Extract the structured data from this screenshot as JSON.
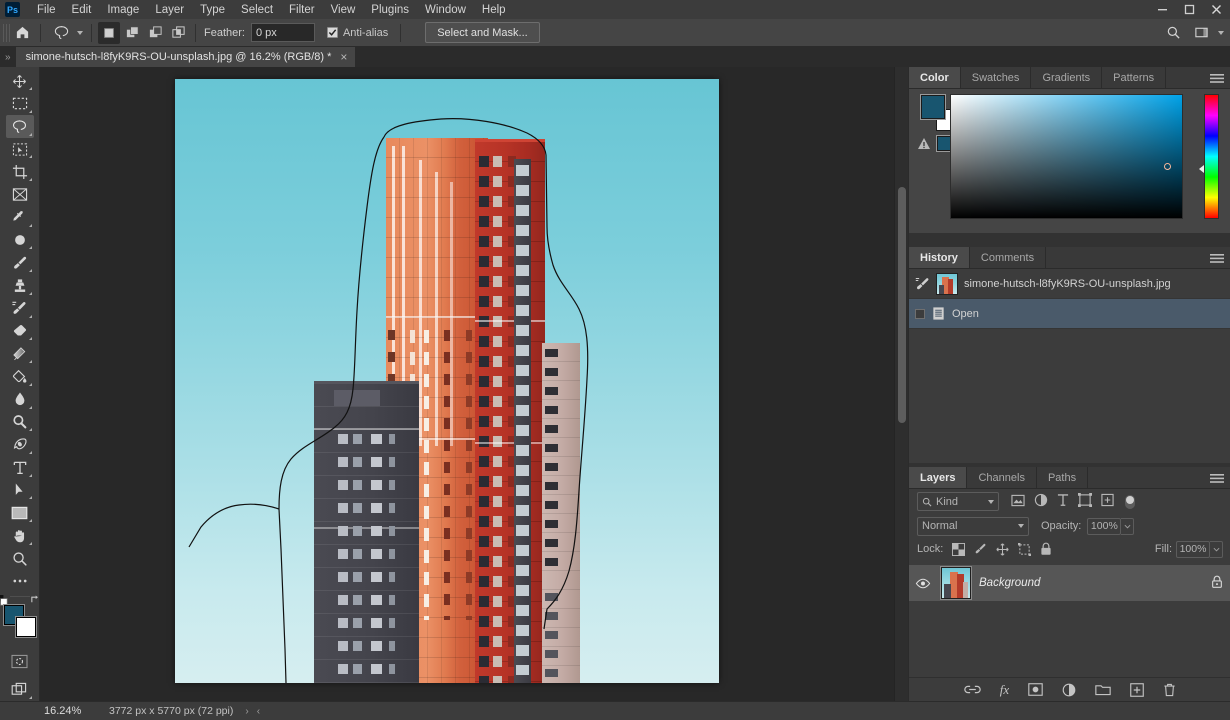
{
  "app": {
    "name": "Adobe Photoshop",
    "logo_text": "Ps"
  },
  "menubar": {
    "items": [
      {
        "label": "File"
      },
      {
        "label": "Edit"
      },
      {
        "label": "Image"
      },
      {
        "label": "Layer"
      },
      {
        "label": "Type"
      },
      {
        "label": "Select"
      },
      {
        "label": "Filter"
      },
      {
        "label": "View"
      },
      {
        "label": "Plugins"
      },
      {
        "label": "Window"
      },
      {
        "label": "Help"
      }
    ]
  },
  "window_controls": {
    "minimize": "minimize-button",
    "maximize": "maximize-button",
    "close": "close-button"
  },
  "options_bar": {
    "home_icon": "home-icon",
    "active_tool_icon": "lasso-tool-icon",
    "selection_modes": [
      {
        "name": "new-selection",
        "active": true
      },
      {
        "name": "add-to-selection",
        "active": false
      },
      {
        "name": "subtract-from-selection",
        "active": false
      },
      {
        "name": "intersect-with-selection",
        "active": false
      }
    ],
    "feather_label": "Feather:",
    "feather_value": "0 px",
    "antialias_label": "Anti-alias",
    "antialias_checked": true,
    "select_and_mask_label": "Select and Mask...",
    "search_icon": "search-icon",
    "workspace_icon": "workspace-switcher-icon"
  },
  "document_tab": {
    "title": "simone-hutsch-l8fyK9RS-OU-unsplash.jpg @ 16.2% (RGB/8) *",
    "close_label": "×",
    "overflow_label": "»"
  },
  "toolbar": {
    "tools": [
      {
        "name": "move-tool",
        "icon": "move-icon",
        "active": false,
        "has_flyout": true
      },
      {
        "name": "rectangular-marquee-tool",
        "icon": "marquee-icon",
        "active": false,
        "has_flyout": true
      },
      {
        "name": "lasso-tool",
        "icon": "lasso-icon",
        "active": true,
        "has_flyout": true
      },
      {
        "name": "object-selection-tool",
        "icon": "object-select-icon",
        "active": false,
        "has_flyout": true
      },
      {
        "name": "crop-tool",
        "icon": "crop-icon",
        "active": false,
        "has_flyout": true
      },
      {
        "name": "frame-tool",
        "icon": "frame-icon",
        "active": false,
        "has_flyout": false
      },
      {
        "name": "eyedropper-tool",
        "icon": "eyedropper-icon",
        "active": false,
        "has_flyout": true
      },
      {
        "name": "spot-healing-brush-tool",
        "icon": "healing-icon",
        "active": false,
        "has_flyout": true
      },
      {
        "name": "brush-tool",
        "icon": "brush-icon",
        "active": false,
        "has_flyout": true
      },
      {
        "name": "clone-stamp-tool",
        "icon": "clone-stamp-icon",
        "active": false,
        "has_flyout": true
      },
      {
        "name": "history-brush-tool",
        "icon": "history-brush-icon",
        "active": false,
        "has_flyout": true
      },
      {
        "name": "eraser-tool",
        "icon": "eraser-icon",
        "active": false,
        "has_flyout": true
      },
      {
        "name": "gradient-tool",
        "icon": "gradient-icon",
        "active": false,
        "has_flyout": true
      },
      {
        "name": "paint-bucket-tool",
        "icon": "paint-bucket-icon",
        "active": false,
        "has_flyout": true
      },
      {
        "name": "blur-tool",
        "icon": "blur-drop-icon",
        "active": false,
        "has_flyout": true
      },
      {
        "name": "dodge-tool",
        "icon": "dodge-icon",
        "active": false,
        "has_flyout": true
      },
      {
        "name": "pen-tool",
        "icon": "pen-icon",
        "active": false,
        "has_flyout": true
      },
      {
        "name": "type-tool",
        "icon": "type-t-icon",
        "active": false,
        "has_flyout": true
      },
      {
        "name": "path-selection-tool",
        "icon": "path-arrow-icon",
        "active": false,
        "has_flyout": true
      },
      {
        "name": "rectangle-tool",
        "icon": "rectangle-icon",
        "active": false,
        "has_flyout": true
      },
      {
        "name": "hand-tool",
        "icon": "hand-icon",
        "active": false,
        "has_flyout": true
      },
      {
        "name": "zoom-tool",
        "icon": "zoom-magnifier-icon",
        "active": false,
        "has_flyout": false
      },
      {
        "name": "edit-toolbar",
        "icon": "ellipsis-icon",
        "active": false,
        "has_flyout": false
      }
    ],
    "foreground_color": "#18556f",
    "background_color": "#ffffff",
    "quick_mask_icon": "quick-mask-icon",
    "screen_mode_icon": "screen-mode-icon",
    "swap_colors_icon": "swap-colors-icon",
    "default_colors_icon": "default-colors-icon"
  },
  "canvas": {
    "document_name": "simone-hutsch-l8fyK9RS-OU-unsplash.jpg",
    "selection_active": true,
    "selection_tool": "lasso",
    "sky_color_top": "#67c5d4",
    "sky_color_bottom": "#d6eef0",
    "orange_building_color": "#e8895c",
    "red_building_color": "#c0392b",
    "grey_building_color": "#4a4a52",
    "beige_building_color": "#cdb8b2"
  },
  "color_panel": {
    "tabs": [
      {
        "label": "Color",
        "active": true
      },
      {
        "label": "Swatches",
        "active": false
      },
      {
        "label": "Gradients",
        "active": false
      },
      {
        "label": "Patterns",
        "active": false
      }
    ],
    "menu_icon": "panel-menu-icon",
    "foreground": "#18556f",
    "background": "#ffffff",
    "out_of_gamut_icon": "gamut-warning-icon",
    "gamut_swatch": "#18556f"
  },
  "history_panel": {
    "tabs": [
      {
        "label": "History",
        "active": true
      },
      {
        "label": "Comments",
        "active": false
      }
    ],
    "menu_icon": "panel-menu-icon",
    "snapshot": {
      "label": "simone-hutsch-l8fyK9RS-OU-unsplash.jpg",
      "icon": "history-brush-source-icon"
    },
    "states": [
      {
        "label": "Open",
        "icon": "open-document-icon",
        "selected": true
      }
    ],
    "footer_icons": [
      {
        "name": "create-document-from-state-icon"
      },
      {
        "name": "create-new-snapshot-icon"
      },
      {
        "name": "delete-state-icon"
      }
    ]
  },
  "layers_panel": {
    "tabs": [
      {
        "label": "Layers",
        "active": true
      },
      {
        "label": "Channels",
        "active": false
      },
      {
        "label": "Paths",
        "active": false
      }
    ],
    "menu_icon": "panel-menu-icon",
    "filter": {
      "kind_label": "Kind",
      "search_icon": "search-icon",
      "type_filters": [
        {
          "name": "filter-pixel-layers-icon"
        },
        {
          "name": "filter-adjustment-layers-icon"
        },
        {
          "name": "filter-type-layers-icon"
        },
        {
          "name": "filter-shape-layers-icon"
        },
        {
          "name": "filter-smart-object-layers-icon"
        }
      ],
      "toggle_name": "filter-enable-toggle"
    },
    "blend_mode": "Normal",
    "opacity_label": "Opacity:",
    "opacity_value": "100%",
    "lock_label": "Lock:",
    "lock_icons": [
      {
        "name": "lock-transparent-pixels-icon"
      },
      {
        "name": "lock-image-pixels-icon"
      },
      {
        "name": "lock-position-icon"
      },
      {
        "name": "lock-artboard-nesting-icon"
      },
      {
        "name": "lock-all-icon"
      }
    ],
    "fill_label": "Fill:",
    "fill_value": "100%",
    "layers": [
      {
        "name": "Background",
        "visible": true,
        "locked": true,
        "selected": true
      }
    ],
    "footer_icons": [
      {
        "name": "link-layers-icon"
      },
      {
        "name": "add-layer-style-icon",
        "label": "fx"
      },
      {
        "name": "add-layer-mask-icon"
      },
      {
        "name": "new-fill-adjustment-layer-icon"
      },
      {
        "name": "new-group-icon"
      },
      {
        "name": "new-layer-icon"
      },
      {
        "name": "delete-layer-icon"
      }
    ]
  },
  "status_bar": {
    "zoom_level": "16.24%",
    "document_dimensions": "3772 px x 5770 px (72 ppi)",
    "expand_arrow": "›",
    "collapse_arrow": "‹"
  }
}
